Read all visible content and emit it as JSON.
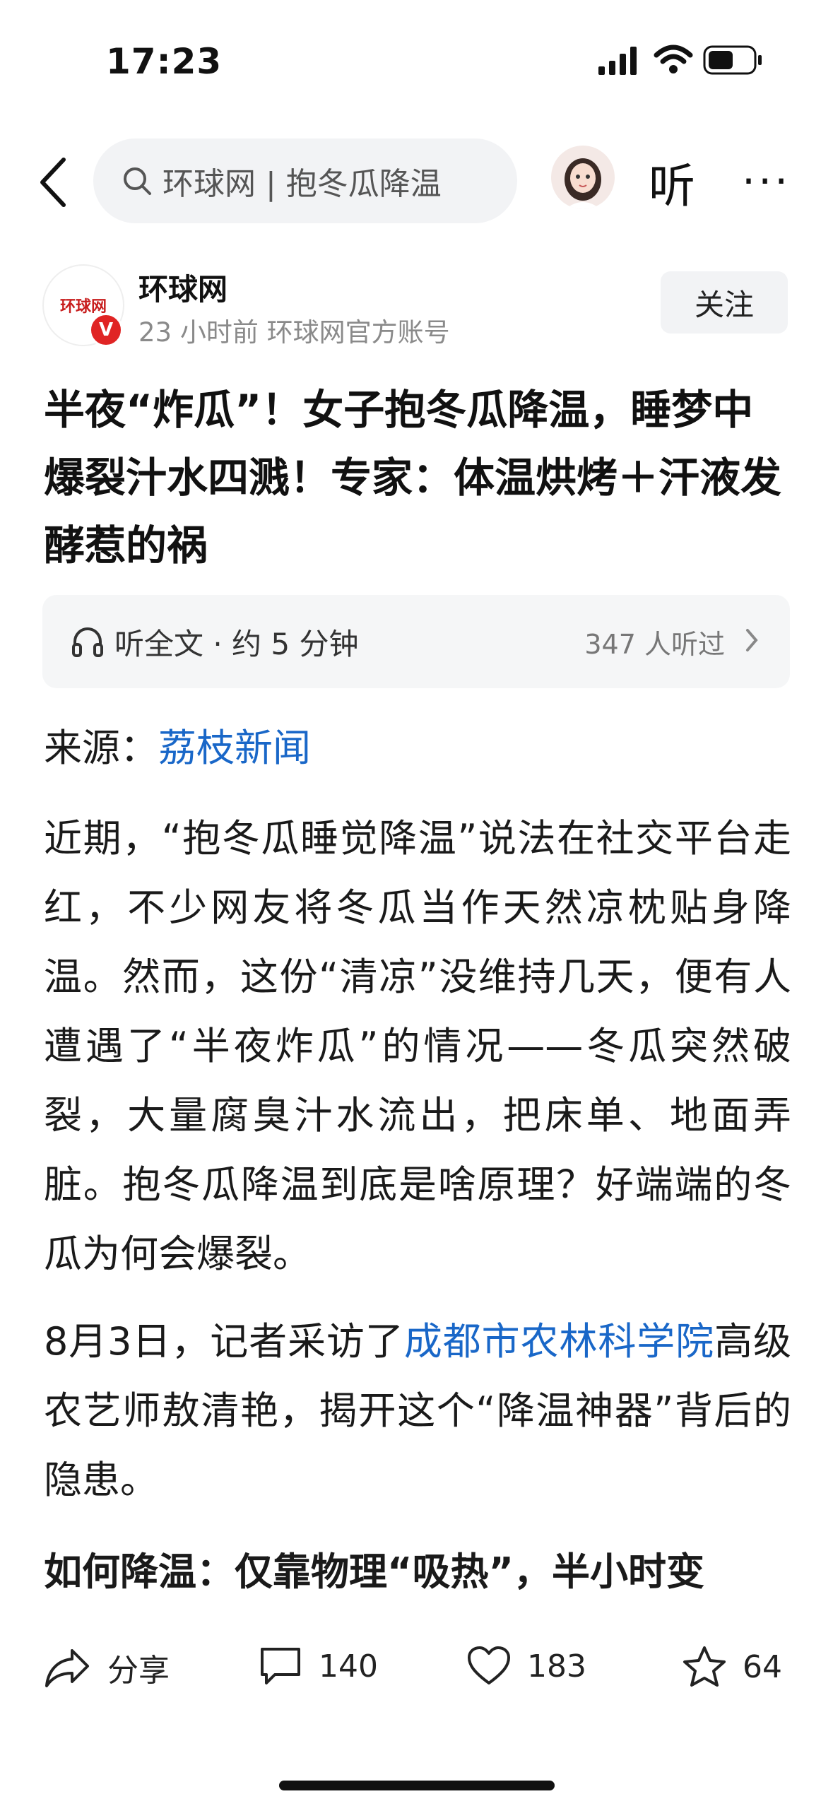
{
  "status_bar": {
    "time": "17:23"
  },
  "nav": {
    "search_text": "环球网 | 抱冬瓜降温",
    "listen_label": "听",
    "more_label": "···"
  },
  "author": {
    "logo_text": "环球网",
    "verified_badge": "V",
    "name": "环球网",
    "meta": "23 小时前  环球网官方账号",
    "follow_label": "关注"
  },
  "article": {
    "title": "半夜“炸瓜”！女子抱冬瓜降温，睡梦中爆裂汁水四溅！专家：体温烘烤＋汗液发酵惹的祸",
    "listen_bar": {
      "label": "听全文 · 约 5 分钟",
      "count": "347 人听过"
    },
    "source_label": "来源：",
    "source_link": "荔枝新闻",
    "paragraph1": "近期，“抱冬瓜睡觉降温”说法在社交平台走红，不少网友将冬瓜当作天然凉枕贴身降温。然而，这份“清凉”没维持几天，便有人遭遇了“半夜炸瓜”的情况——冬瓜突然破裂，大量腐臭汁水流出，把床单、地面弄脏。抱冬瓜降温到底是啥原理？好端端的冬瓜为何会爆裂。",
    "paragraph2_prefix": "8月3日，记者采访了",
    "paragraph2_link": "成都市农林科学院",
    "paragraph2_suffix": "高级农艺师敖清艳，揭开这个“降温神器”背后的隐患。",
    "subhead": "如何降温：仅靠物理“吸热”，半小时变"
  },
  "bottom_bar": {
    "share_label": "分享",
    "comment_count": "140",
    "like_count": "183",
    "star_count": "64"
  },
  "colors": {
    "link": "#1967c8",
    "verified": "#e02424"
  },
  "icons": [
    "back-arrow-icon",
    "search-icon",
    "headphones-icon",
    "chevron-right-icon",
    "share-icon",
    "comment-icon",
    "heart-icon",
    "star-icon"
  ]
}
